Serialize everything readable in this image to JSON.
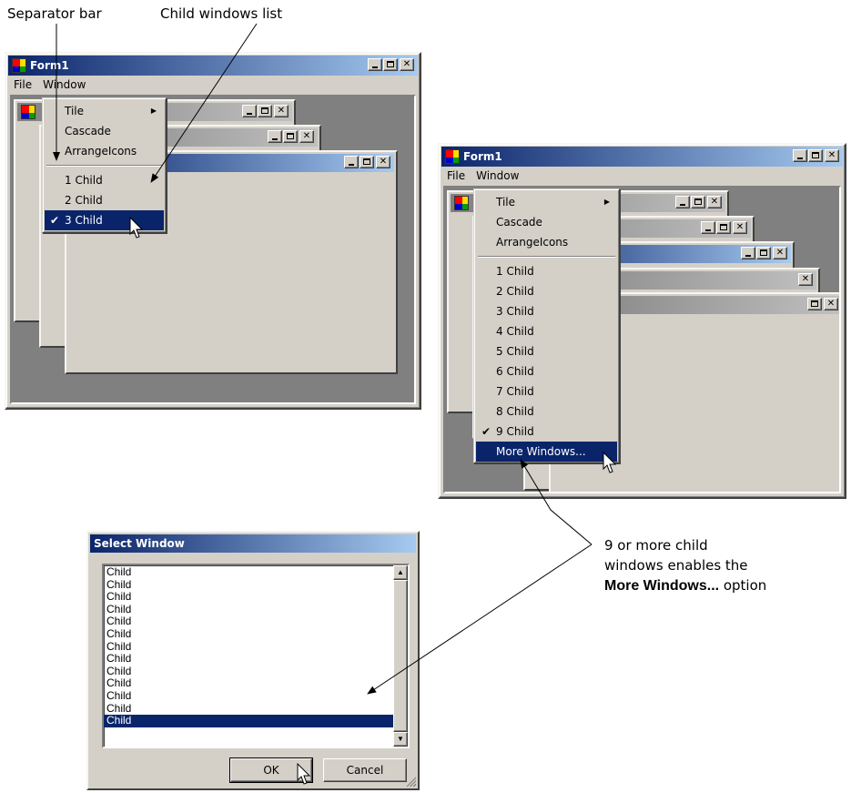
{
  "callouts": {
    "separator_bar": "Separator bar",
    "child_windows_list": "Child windows list",
    "more_windows_note_line1": "9 or more child",
    "more_windows_note_line2": "windows enables the",
    "more_windows_note_bold": "More Windows...",
    "more_windows_note_tail": " option"
  },
  "form_left": {
    "title": "Form1",
    "menubar": [
      "File",
      "Window"
    ],
    "window_menu": {
      "items": [
        "Tile",
        "Cascade",
        "ArrangeIcons"
      ],
      "children": [
        "1 Child",
        "2 Child",
        "3 Child"
      ],
      "checked": "3 Child",
      "checkmark": "✔",
      "submenu_arrow": "▶"
    }
  },
  "form_right": {
    "title": "Form1",
    "menubar": [
      "File",
      "Window"
    ],
    "window_menu": {
      "items": [
        "Tile",
        "Cascade",
        "ArrangeIcons"
      ],
      "children": [
        "1 Child",
        "2 Child",
        "3 Child",
        "4 Child",
        "5 Child",
        "6 Child",
        "7 Child",
        "8 Child",
        "9 Child"
      ],
      "checked": "9 Child",
      "more": "More Windows...",
      "checkmark": "✔",
      "submenu_arrow": "▶"
    }
  },
  "caption_glyphs": {
    "close": "✕"
  },
  "dialog": {
    "title": "Select Window",
    "list_items": [
      "Child",
      "Child",
      "Child",
      "Child",
      "Child",
      "Child",
      "Child",
      "Child",
      "Child",
      "Child",
      "Child",
      "Child",
      "Child"
    ],
    "selected_index": 12,
    "scroll_up": "▲",
    "scroll_down": "▼",
    "ok_label": "OK",
    "cancel_label": "Cancel"
  },
  "colors": {
    "title_active": "#0a246a",
    "title_inactive": "#808080",
    "face": "#d4d0c8",
    "mdi_background": "#808080",
    "selection": "#0a246a"
  }
}
